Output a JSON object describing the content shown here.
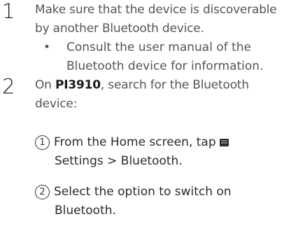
{
  "step1": {
    "number": "1",
    "line1": "Make sure that the device is discoverable",
    "line2": "by another Bluetooth device.",
    "bullet_symbol": "•",
    "bullet_line1": "Consult the user manual of the",
    "bullet_line2": "Bluetooth device for information."
  },
  "step2": {
    "number": "2",
    "prefix": "On ",
    "device": "PI3910",
    "line1_rest": ", search for the Bluetooth",
    "line2": "device:",
    "sub1": {
      "marker": "1",
      "line1": "From the Home screen, tap",
      "icon": "settings-app-icon",
      "line2": "Settings > Bluetooth."
    },
    "sub2": {
      "marker": "2",
      "line1": "Select the option to switch on",
      "line2": "Bluetooth."
    }
  }
}
